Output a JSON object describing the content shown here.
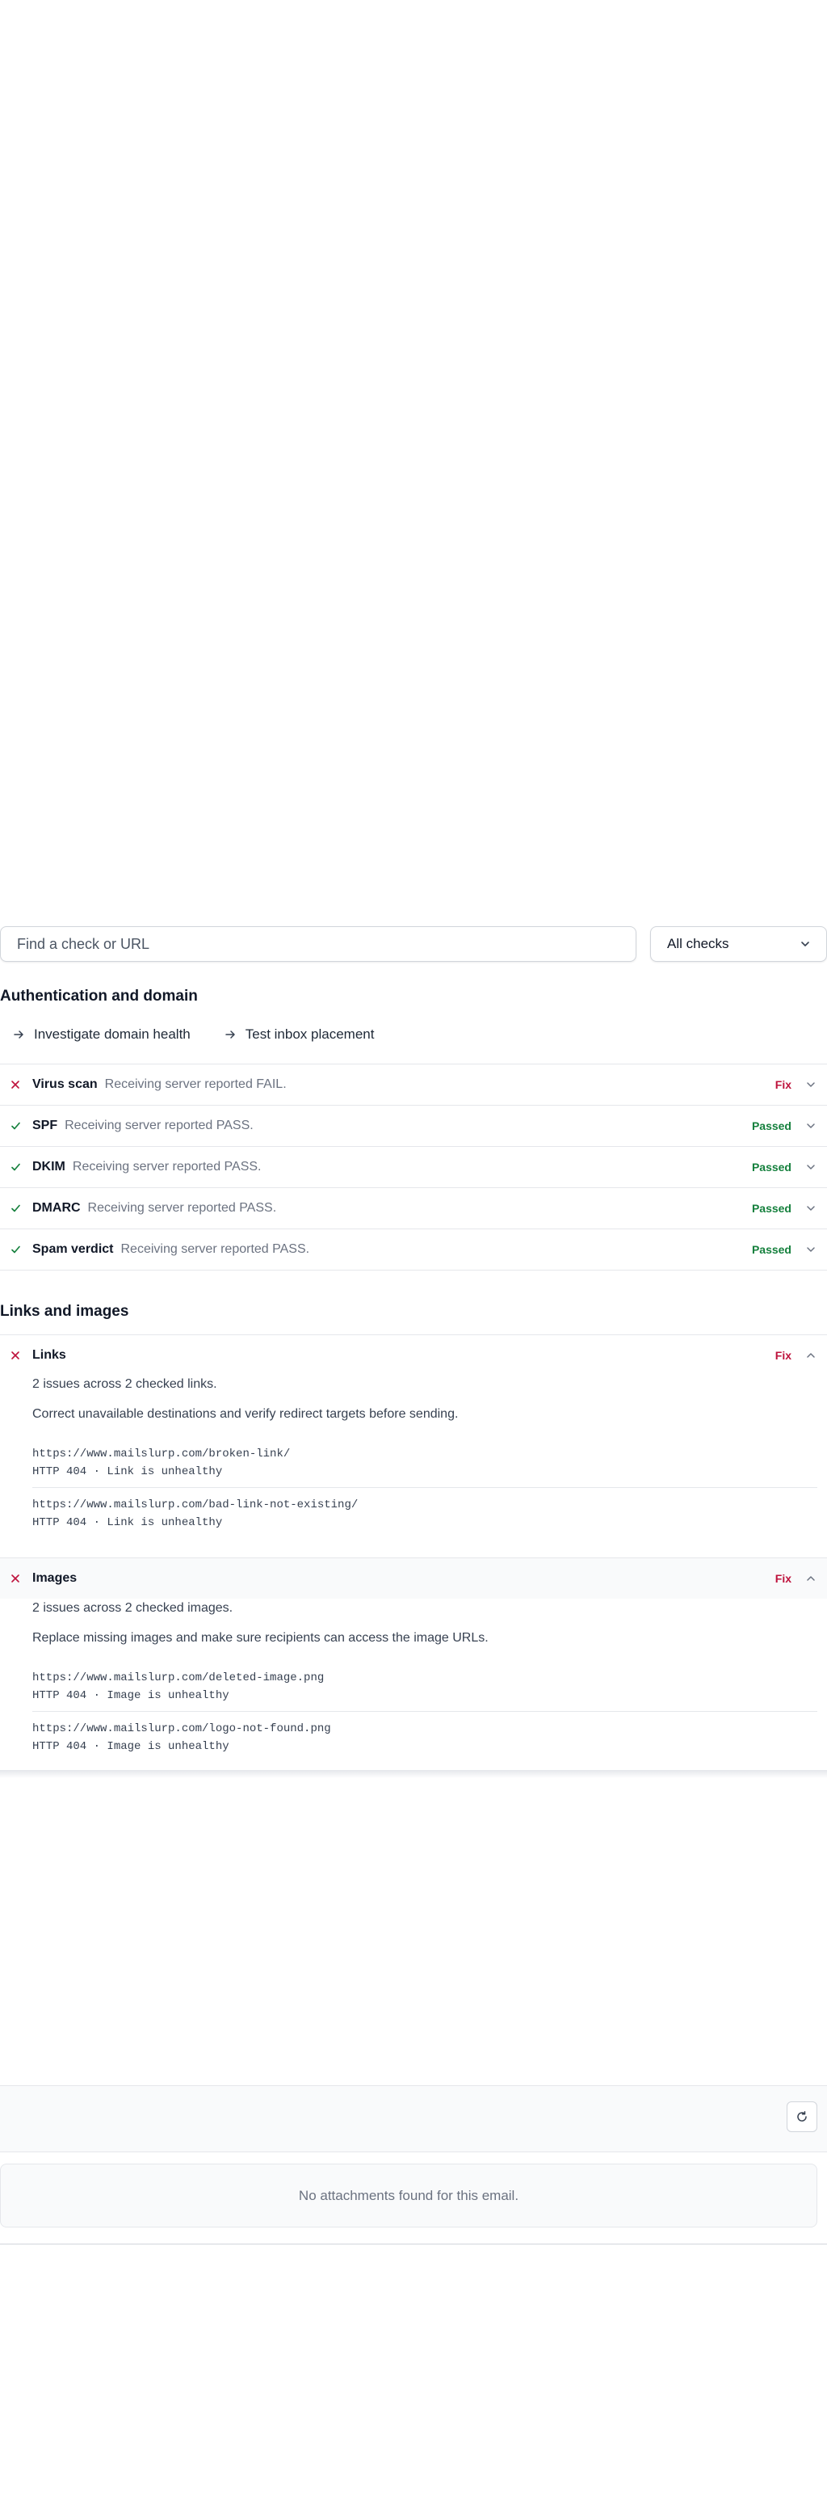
{
  "search": {
    "placeholder": "Find a check or URL"
  },
  "filter": {
    "selected": "All checks"
  },
  "auth_section": {
    "title": "Authentication and domain",
    "actions": [
      "Investigate domain health",
      "Test inbox placement"
    ],
    "checks": [
      {
        "name": "Virus scan",
        "description": "Receiving server reported FAIL.",
        "status": "Fix",
        "result": "fail"
      },
      {
        "name": "SPF",
        "description": "Receiving server reported PASS.",
        "status": "Passed",
        "result": "pass"
      },
      {
        "name": "DKIM",
        "description": "Receiving server reported PASS.",
        "status": "Passed",
        "result": "pass"
      },
      {
        "name": "DMARC",
        "description": "Receiving server reported PASS.",
        "status": "Passed",
        "result": "pass"
      },
      {
        "name": "Spam verdict",
        "description": "Receiving server reported PASS.",
        "status": "Passed",
        "result": "pass"
      }
    ]
  },
  "links_section": {
    "title": "Links and images",
    "links": {
      "name": "Links",
      "status": "Fix",
      "summary": "2 issues across 2 checked links.",
      "advice": "Correct unavailable destinations and verify redirect targets before sending.",
      "items": [
        {
          "url": "https://www.mailslurp.com/broken-link/",
          "detail": "HTTP 404 · Link is unhealthy"
        },
        {
          "url": "https://www.mailslurp.com/bad-link-not-existing/",
          "detail": "HTTP 404 · Link is unhealthy"
        }
      ]
    },
    "images": {
      "name": "Images",
      "status": "Fix",
      "summary": "2 issues across 2 checked images.",
      "advice": "Replace missing images and make sure recipients can access the image URLs.",
      "items": [
        {
          "url": "https://www.mailslurp.com/deleted-image.png",
          "detail": "HTTP 404 · Image is unhealthy"
        },
        {
          "url": "https://www.mailslurp.com/logo-not-found.png",
          "detail": "HTTP 404 · Image is unhealthy"
        }
      ]
    }
  },
  "attachments": {
    "empty_message": "No attachments found for this email."
  },
  "colors": {
    "pass": "#15803d",
    "fail": "#be123c",
    "border": "#e5e7eb"
  },
  "icons": [
    "x-icon",
    "check-icon",
    "chevron-down-icon",
    "chevron-up-icon",
    "arrow-right-icon",
    "refresh-icon"
  ]
}
